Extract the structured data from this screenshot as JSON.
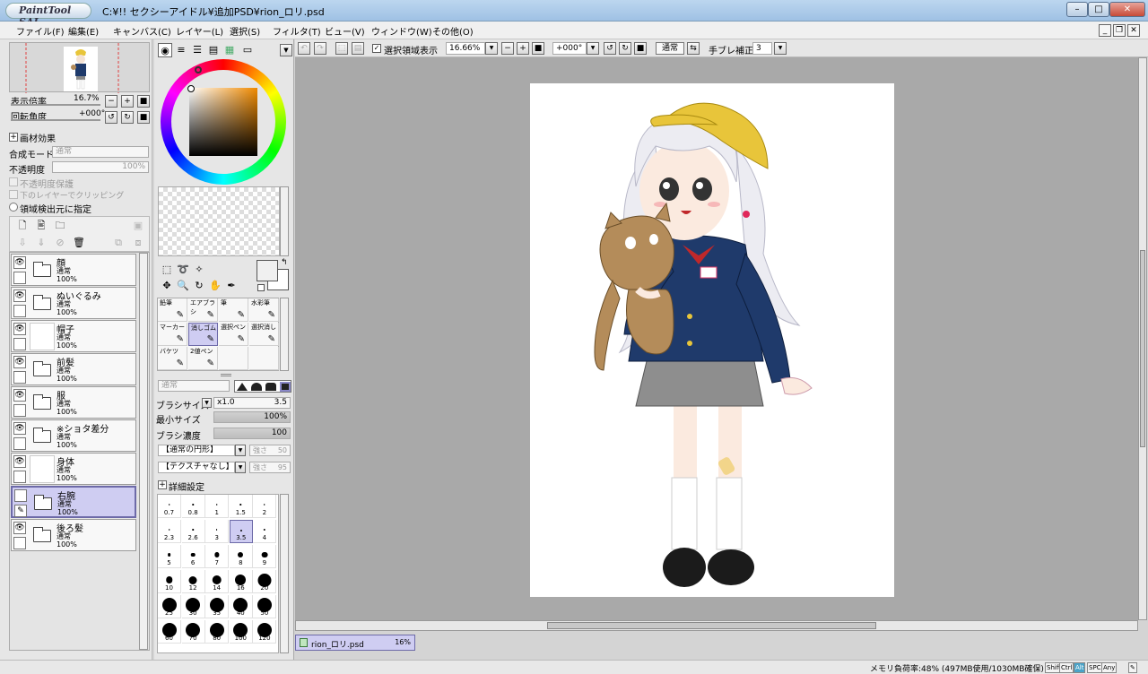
{
  "window": {
    "app_logo": "PaintTool SAI",
    "title": "C:¥!! セクシーアイドル¥追加PSD¥rion_ロリ.psd"
  },
  "menu": [
    "ファイル(F)",
    "編集(E)",
    "キャンバス(C)",
    "レイヤー(L)",
    "選択(S)",
    "フィルタ(T)",
    "ビュー(V)",
    "ウィンドウ(W)",
    "その他(O)"
  ],
  "navigator": {
    "zoom_label": "表示倍率",
    "zoom_value": "16.7%",
    "rotate_label": "回転角度",
    "rotate_value": "+000°"
  },
  "layer_props": {
    "paper_effect": "画材効果",
    "blend_mode_label": "合成モード",
    "blend_mode_value": "通常",
    "opacity_label": "不透明度",
    "opacity_value": "100%",
    "preserve_opacity": "不透明度保護",
    "clip_lower": "下のレイヤーでクリッピング",
    "selection_source": "領域検出元に指定"
  },
  "layers": [
    {
      "name": "顔",
      "mode": "通常",
      "opacity": "100%",
      "type": "folder",
      "visible": true,
      "selected": false
    },
    {
      "name": "ぬいぐるみ",
      "mode": "通常",
      "opacity": "100%",
      "type": "folder",
      "visible": true,
      "selected": false
    },
    {
      "name": "帽子",
      "mode": "通常",
      "opacity": "100%",
      "type": "image",
      "visible": true,
      "selected": false
    },
    {
      "name": "前髪",
      "mode": "通常",
      "opacity": "100%",
      "type": "folder",
      "visible": true,
      "selected": false
    },
    {
      "name": "服",
      "mode": "通常",
      "opacity": "100%",
      "type": "folder",
      "visible": true,
      "selected": false
    },
    {
      "name": "※ショタ差分",
      "mode": "通常",
      "opacity": "100%",
      "type": "folder",
      "visible": true,
      "selected": false
    },
    {
      "name": "身体",
      "mode": "通常",
      "opacity": "100%",
      "type": "image",
      "visible": true,
      "selected": false
    },
    {
      "name": "右腕",
      "mode": "通常",
      "opacity": "100%",
      "type": "folder",
      "visible": false,
      "selected": true
    },
    {
      "name": "後ろ髪",
      "mode": "通常",
      "opacity": "100%",
      "type": "folder",
      "visible": true,
      "selected": false
    }
  ],
  "tools": {
    "brushes": [
      {
        "label": "鉛筆"
      },
      {
        "label": "エアブラシ"
      },
      {
        "label": "筆"
      },
      {
        "label": "水彩筆"
      },
      {
        "label": "マーカー"
      },
      {
        "label": "消しゴム"
      },
      {
        "label": "選択ペン"
      },
      {
        "label": "選択消し"
      },
      {
        "label": "バケツ"
      },
      {
        "label": "2値ペン"
      },
      {
        "label": ""
      },
      {
        "label": ""
      }
    ],
    "selected_brush": "消しゴム"
  },
  "brush_settings": {
    "blend_mode": "通常",
    "size_label": "ブラシサイズ",
    "size_mult": "x1.0",
    "size_value": "3.5",
    "min_size_label": "最小サイズ",
    "min_size_value": "100%",
    "density_label": "ブラシ濃度",
    "density_value": "100",
    "shape": "【通常の円形】",
    "shape_strength_label": "強さ",
    "shape_strength": "50",
    "texture": "【テクスチャなし】",
    "texture_strength_label": "強さ",
    "texture_strength": "95",
    "advanced": "詳細設定"
  },
  "brush_sizes": [
    "0.7",
    "0.8",
    "1",
    "1.5",
    "2",
    "2.3",
    "2.6",
    "3",
    "3.5",
    "4",
    "5",
    "6",
    "7",
    "8",
    "9",
    "10",
    "12",
    "14",
    "16",
    "20",
    "25",
    "30",
    "35",
    "40",
    "50",
    "60",
    "70",
    "80",
    "100",
    "120"
  ],
  "selected_size": "3.5",
  "canvas_toolbar": {
    "show_selection": "選択領域表示",
    "zoom": "16.66%",
    "rotation": "+000°",
    "blend": "通常",
    "stabilizer_label": "手ブレ補正",
    "stabilizer_value": "3"
  },
  "doc_tab": {
    "name": "rion_ロリ.psd",
    "zoom": "16%"
  },
  "status": {
    "memory": "メモリ負荷率:48% (497MB使用/1030MB確保)",
    "keys": [
      "Shift",
      "Ctrl",
      "Alt",
      "SPC",
      "Any"
    ]
  },
  "colors": {
    "selection": "#cfcdf2",
    "workspace": "#a9a9a9",
    "jacket": "#1f3a6b",
    "hat": "#e8c53a",
    "hair": "#e8e8ee"
  }
}
